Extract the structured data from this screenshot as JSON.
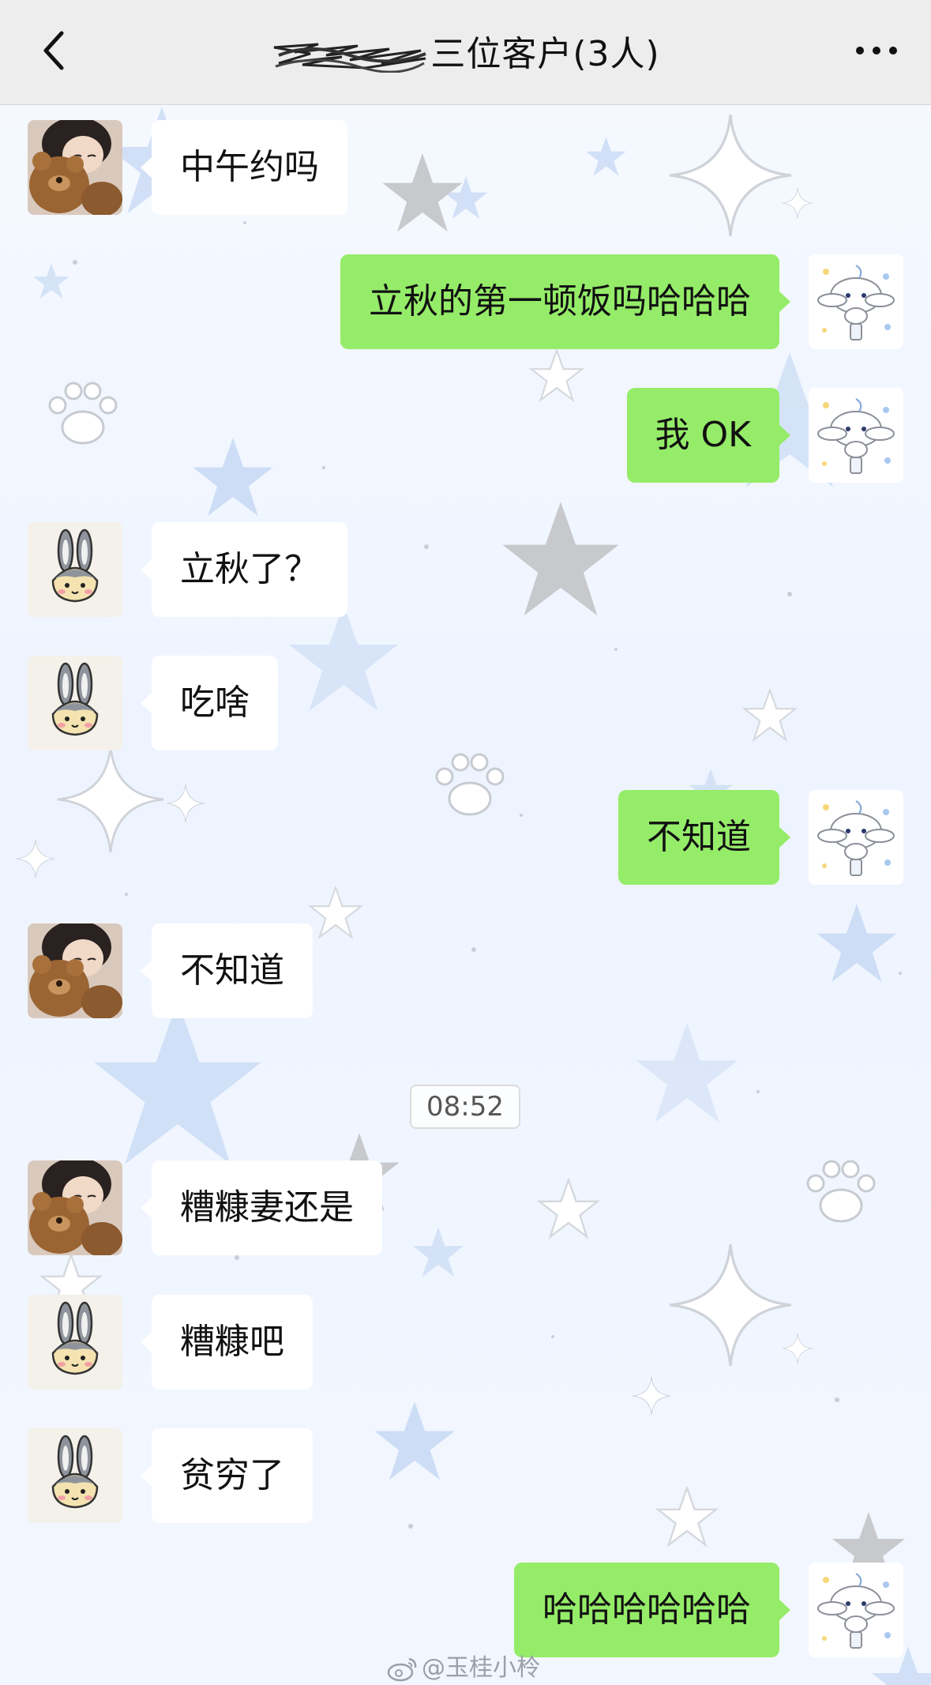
{
  "header": {
    "title": "三位客户(3人)",
    "back_icon": "chevron-left-icon",
    "more_icon": "ellipsis-icon"
  },
  "messages": [
    {
      "side": "left",
      "avatar": "girl-with-teddy-bear-avatar",
      "text": "中午约吗"
    },
    {
      "side": "right",
      "avatar": "white-puppy-avatar",
      "text": "立秋的第一顿饭吗哈哈哈"
    },
    {
      "side": "right",
      "avatar": "white-puppy-avatar",
      "text": "我 OK"
    },
    {
      "side": "left",
      "avatar": "bunny-avatar",
      "text": "立秋了？"
    },
    {
      "side": "left",
      "avatar": "bunny-avatar",
      "text": "吃啥"
    },
    {
      "side": "right",
      "avatar": "white-puppy-avatar",
      "text": "不知道"
    },
    {
      "side": "left",
      "avatar": "girl-with-teddy-bear-avatar",
      "text": "不知道"
    },
    {
      "side": "left",
      "avatar": "girl-with-teddy-bear-avatar",
      "text": "糟糠妻还是"
    },
    {
      "side": "left",
      "avatar": "bunny-avatar",
      "text": "糟糠吧"
    },
    {
      "side": "left",
      "avatar": "bunny-avatar",
      "text": "贫穷了"
    },
    {
      "side": "right",
      "avatar": "white-puppy-avatar",
      "text": "哈哈哈哈哈哈"
    }
  ],
  "timestamp": "08:52",
  "watermark": "@玉桂小柃",
  "colors": {
    "nav_bg": "#ededed",
    "sent_bubble": "#95ec69",
    "received_bubble": "#ffffff",
    "wallpaper": "#eef4ff"
  }
}
